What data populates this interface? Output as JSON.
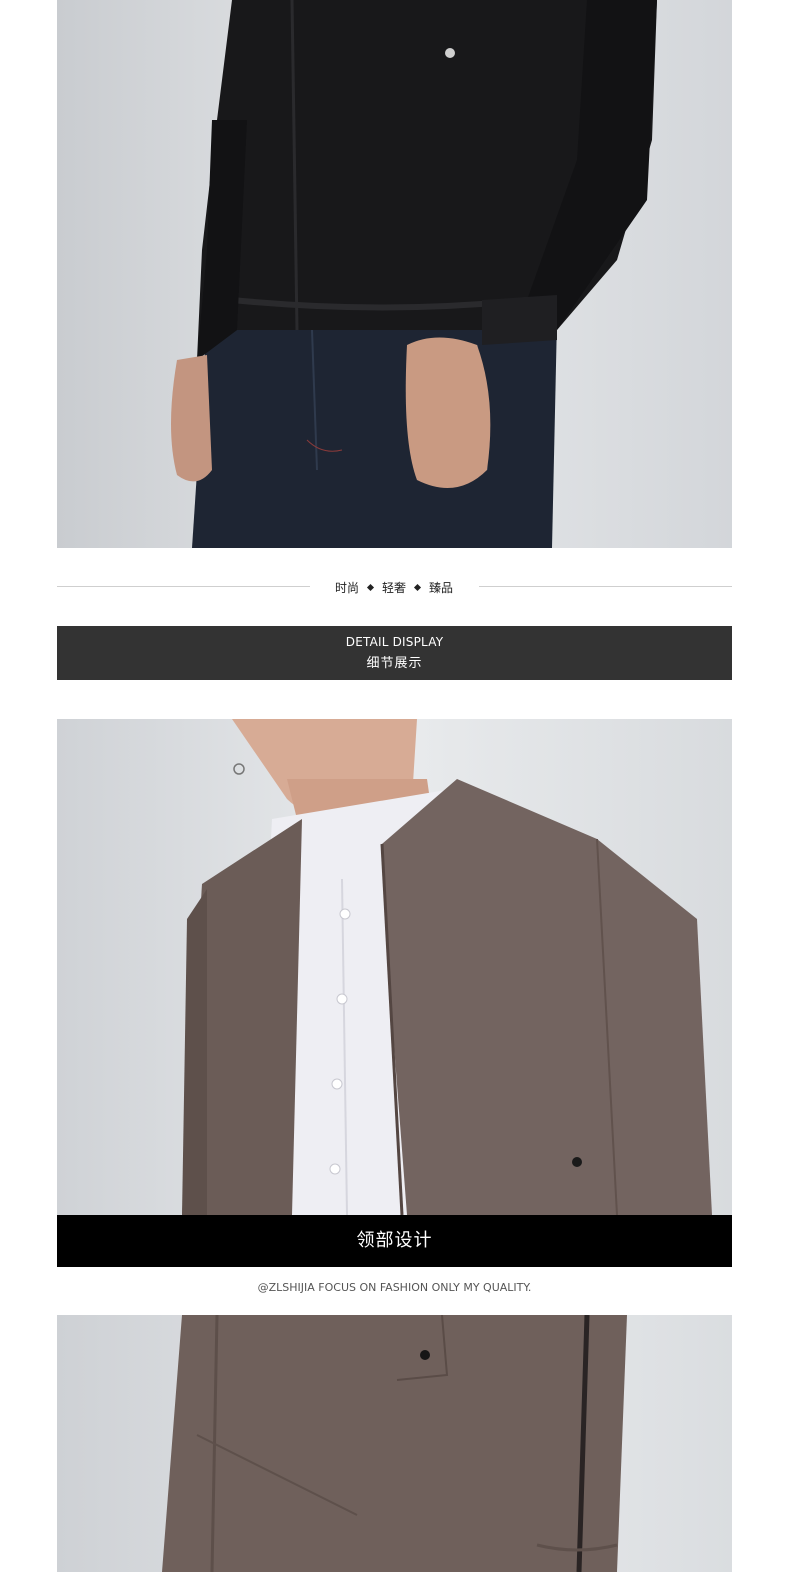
{
  "tagline": {
    "words": [
      "时尚",
      "轻奢",
      "臻品"
    ]
  },
  "detail_banner": {
    "en": "DETAIL DISPLAY",
    "cn": "细节展示"
  },
  "collar_caption": "领部设计",
  "brand_line": "@ZLSHIJIA  FOCUS ON FASHION ONLY MY QUALITY.",
  "colors": {
    "banner_bg": "#333333",
    "caption_bg": "#000000",
    "jacket_black": "#1a1a1c",
    "jacket_brown": "#6e5f5a",
    "photo_bg": "#dfe1e4"
  }
}
